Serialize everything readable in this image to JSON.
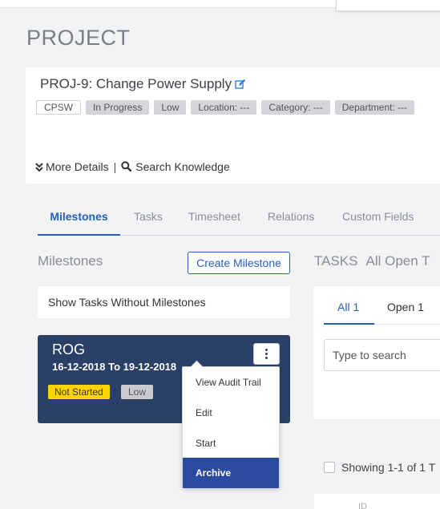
{
  "page": {
    "title": "PROJECT"
  },
  "project": {
    "name": "PROJ-9: Change Power Supply",
    "tags": [
      "CPSW",
      "In Progress",
      "Low",
      "Location: ---",
      "Category: ---",
      "Department: ---"
    ],
    "more_details": "More Details",
    "separator": "|",
    "search_knowledge": "Search Knowledge"
  },
  "tabs": [
    "Milestones",
    "Tasks",
    "Timesheet",
    "Relations",
    "Custom Fields"
  ],
  "active_tab": "Milestones",
  "milestones": {
    "heading": "Milestones",
    "create_button": "Create Milestone",
    "show_tasks_without": "Show Tasks Without Milestones",
    "card": {
      "title": "ROG",
      "date_range": "16-12-2018 To 19-12-2018",
      "status": "Not Started",
      "priority": "Low"
    },
    "menu": {
      "items": [
        "View Audit Trail",
        "Edit",
        "Start",
        "Archive"
      ],
      "highlighted": "Archive"
    }
  },
  "tasks_panel": {
    "heading": "TASKS",
    "filter": "All Open T",
    "tabs": [
      "All 1",
      "Open 1"
    ],
    "search_placeholder": "Type to search",
    "showing": "Showing 1-1 of 1 T",
    "column_header": "ID"
  },
  "colors": {
    "accent": "#2460b5",
    "milestone_card": "#2b4066",
    "not_started_badge": "#ffd400",
    "menu_highlight": "#2a4ba0"
  }
}
